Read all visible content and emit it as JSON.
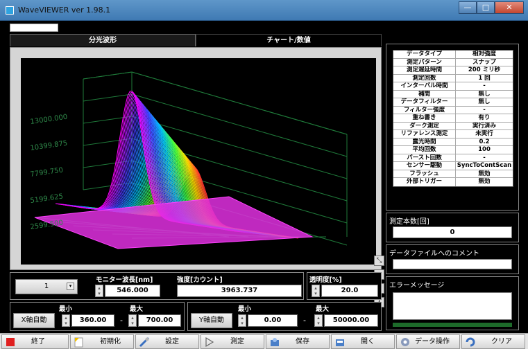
{
  "window": {
    "title": "WaveVIEWER ver 1.98.1",
    "controls": {
      "minimize": "—",
      "maximize": "□",
      "close": "✕"
    }
  },
  "tabs": [
    {
      "label": "分光波形",
      "active": true
    },
    {
      "label": "チャート/数値",
      "active": false
    }
  ],
  "graph": {
    "z_ticks": [
      "13000.000",
      "10399.875",
      "7799.750",
      "5199.625",
      "2599.500"
    ],
    "line_colors": [
      "#ff3030",
      "#ffe000",
      "#40ff40",
      "#00c0ff",
      "#4040ff",
      "#ff00ff"
    ]
  },
  "params": [
    {
      "key": "データタイプ",
      "value": "相対強度"
    },
    {
      "key": "測定パターン",
      "value": "スナップ"
    },
    {
      "key": "測定遅延時間",
      "value": "200 ミリ秒"
    },
    {
      "key": "測定回数",
      "value": "1 回"
    },
    {
      "key": "インターバル時間",
      "value": "-"
    },
    {
      "key": "補間",
      "value": "無し"
    },
    {
      "key": "データフィルター",
      "value": "無し"
    },
    {
      "key": "フィルター強度",
      "value": "-"
    },
    {
      "key": "重ね書き",
      "value": "有り"
    },
    {
      "key": "ダーク測定",
      "value": "実行済み"
    },
    {
      "key": "リファレンス測定",
      "value": "未実行"
    },
    {
      "key": "露光時間",
      "value": "0.2"
    },
    {
      "key": "平均回数",
      "value": "100"
    },
    {
      "key": "バースト回数",
      "value": "-"
    },
    {
      "key": "センサー駆動",
      "value": "SyncToContScan"
    },
    {
      "key": "フラッシュ",
      "value": "無効"
    },
    {
      "key": "外部トリガー",
      "value": "無効"
    }
  ],
  "count": {
    "label": "測定本数[回]",
    "value": "0"
  },
  "comment": {
    "label": "データファイルへのコメント",
    "value": ""
  },
  "error": {
    "label": "エラーメッセージ",
    "value": ""
  },
  "monitor": {
    "selector_value": "1",
    "wavelength_label": "モニター波長[nm]",
    "wavelength_value": "546.000",
    "intensity_label": "強度[カウント]",
    "intensity_value": "3963.737",
    "transparency_label": "透明度[%]",
    "transparency_value": "20.0"
  },
  "x_axis": {
    "auto_label": "X軸自動",
    "min_label": "最小",
    "max_label": "最大",
    "min_value": "360.00",
    "max_value": "700.00",
    "sep": "-"
  },
  "y_axis": {
    "auto_label": "Y軸自動",
    "min_label": "最小",
    "max_label": "最大",
    "min_value": "0.00",
    "max_value": "50000.00",
    "sep": "-"
  },
  "toolbar": [
    {
      "label": "終了",
      "icon": "stop-icon"
    },
    {
      "label": "初期化",
      "icon": "init-icon"
    },
    {
      "label": "設定",
      "icon": "settings-icon"
    },
    {
      "label": "測定",
      "icon": "play-icon"
    },
    {
      "label": "保存",
      "icon": "save-icon"
    },
    {
      "label": "開く",
      "icon": "open-icon"
    },
    {
      "label": "データ操作",
      "icon": "data-ops-icon"
    },
    {
      "label": "クリア",
      "icon": "clear-icon"
    }
  ]
}
